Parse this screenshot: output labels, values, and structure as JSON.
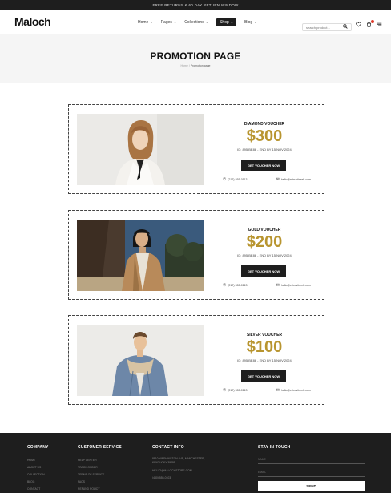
{
  "announcement": "FREE RETURNS & 60 DAY RETURN WINDOW",
  "header": {
    "logo": "Maloch",
    "nav": [
      {
        "label": "Home",
        "chev": "⌄"
      },
      {
        "label": "Pages",
        "chev": "⌄"
      },
      {
        "label": "Collections",
        "chev": "⌄"
      },
      {
        "label": "Shop",
        "chev": "⌄",
        "active": true
      },
      {
        "label": "Blog",
        "chev": "⌄"
      }
    ],
    "search_placeholder": "search product...",
    "icons": [
      "search-icon",
      "heart-icon",
      "cart-icon",
      "menu-icon"
    ],
    "accent_badge": "#e03a2b"
  },
  "hero": {
    "title": "PROMOTION PAGE",
    "breadcrumb_home": "Home",
    "breadcrumb_sep": "/",
    "breadcrumb_current": "Promotion page"
  },
  "vouchers": [
    {
      "title": "DIAMOND VOUCHER",
      "amount": "$300",
      "meta": "ID: 895 BE86 - END BY 15 NOV 2024",
      "button": "GET VOUCHER NOW",
      "phone": "(217) 555-0113",
      "email": "hello@e-trustireeb.com"
    },
    {
      "title": "GOLD VOUCHER",
      "amount": "$200",
      "meta": "ID: 895 BE86 - END BY 15 NOV 2024",
      "button": "GET VOUCHER NOW",
      "phone": "(217) 555-0113",
      "email": "hello@e-trustireeb.com"
    },
    {
      "title": "SILVER VOUCHER",
      "amount": "$100",
      "meta": "ID: 895 BE86 - END BY 15 NOV 2024",
      "button": "GET VOUCHER NOW",
      "phone": "(217) 555-0113",
      "email": "hello@e-trustireeb.com"
    }
  ],
  "colors": {
    "gold": "#b89530",
    "dark": "#1e1e1e"
  },
  "footer": {
    "company": {
      "title": "COMPANY",
      "links": [
        "HOME",
        "ABOUT US",
        "COLLECTION",
        "BLOG",
        "CONTACT"
      ]
    },
    "customer": {
      "title": "CUSTOMER SERVICS",
      "links": [
        "HELP CENTER",
        "TRACK ORDER",
        "TERMS OF SERVICE",
        "FAQS",
        "REFUND POLICY"
      ]
    },
    "contact": {
      "title": "CONTACT INFO",
      "address": "8910 WASHINGTON AVE, MANCHESTER, KENTUCKY 39495",
      "email": "HELLO@MALOCHSTORE.COM",
      "phone": "(480) 555-0103"
    },
    "stay": {
      "title": "STAY IN TOUCH",
      "name_placeholder": "NAME",
      "email_placeholder": "EMAIL",
      "send": "SEND"
    }
  }
}
